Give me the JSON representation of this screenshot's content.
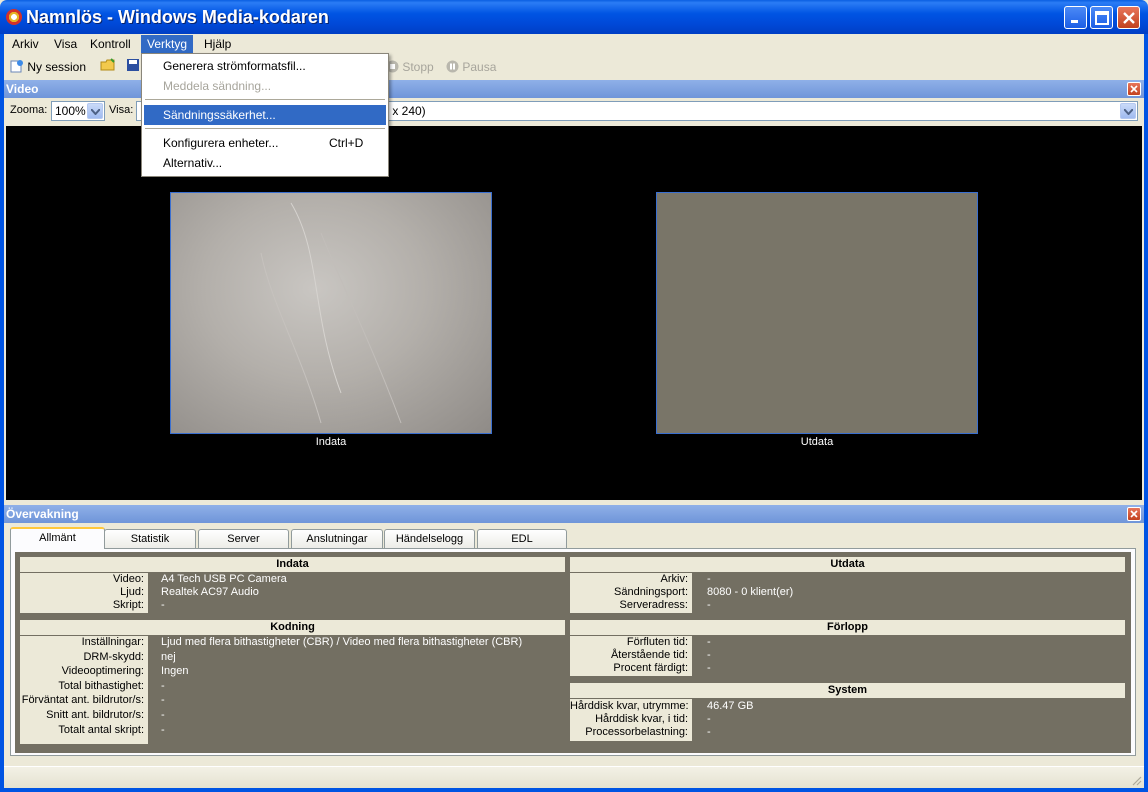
{
  "window": {
    "title": "Namnlös - Windows Media-kodaren"
  },
  "menubar": {
    "items": [
      "Arkiv",
      "Visa",
      "Kontroll",
      "Verktyg",
      "Hjälp"
    ],
    "active": "Verktyg"
  },
  "toolbar": {
    "new_session": "Ny session",
    "stop": "Stopp",
    "pause": "Pausa"
  },
  "dropdown": {
    "items": [
      {
        "label": "Generera strömformatsfil...",
        "state": "enabled"
      },
      {
        "label": "Meddela sändning...",
        "state": "disabled"
      },
      {
        "label": "Sändningssäkerhet...",
        "state": "highlighted"
      },
      {
        "label": "Konfigurera enheter...",
        "shortcut": "Ctrl+D",
        "state": "enabled"
      },
      {
        "label": "Alternativ...",
        "state": "enabled"
      }
    ]
  },
  "video_panel": {
    "title": "Video",
    "zoom_label": "Zooma:",
    "zoom_value": "100%",
    "view_label": "Visa:",
    "view_value_visible": ") x 240)",
    "input_label": "Indata",
    "output_label": "Utdata"
  },
  "monitor_panel": {
    "title": "Övervakning",
    "tabs": [
      "Allmänt",
      "Statistik",
      "Server",
      "Anslutningar",
      "Händelselogg",
      "EDL"
    ],
    "active_tab": "Allmänt",
    "input": {
      "title": "Indata",
      "rows": [
        {
          "label": "Video:",
          "value": "A4 Tech USB PC Camera"
        },
        {
          "label": "Ljud:",
          "value": "Realtek AC97 Audio"
        },
        {
          "label": "Skript:",
          "value": "-"
        }
      ]
    },
    "encoding": {
      "title": "Kodning",
      "rows": [
        {
          "label": "Inställningar:",
          "value": "Ljud med flera bithastigheter (CBR) / Video med flera bithastigheter (CBR)"
        },
        {
          "label": "DRM-skydd:",
          "value": "nej"
        },
        {
          "label": "Videooptimering:",
          "value": "Ingen"
        },
        {
          "label": "Total bithastighet:",
          "value": "-"
        },
        {
          "label": "Förväntat ant. bildrutor/s:",
          "value": "-"
        },
        {
          "label": "Snitt ant. bildrutor/s:",
          "value": "-"
        },
        {
          "label": "Totalt antal skript:",
          "value": "-"
        }
      ]
    },
    "output": {
      "title": "Utdata",
      "rows": [
        {
          "label": "Arkiv:",
          "value": "-"
        },
        {
          "label": "Sändningsport:",
          "value": "8080 - 0 klient(er)"
        },
        {
          "label": "Serveradress:",
          "value": "-"
        }
      ]
    },
    "progress": {
      "title": "Förlopp",
      "rows": [
        {
          "label": "Förfluten tid:",
          "value": "-"
        },
        {
          "label": "Återstående tid:",
          "value": "-"
        },
        {
          "label": "Procent färdigt:",
          "value": "-"
        }
      ]
    },
    "system": {
      "title": "System",
      "rows": [
        {
          "label": "Hårddisk kvar, utrymme:",
          "value": "46.47 GB"
        },
        {
          "label": "Hårddisk kvar, i tid:",
          "value": "-"
        },
        {
          "label": "Processorbelastning:",
          "value": "-"
        }
      ]
    }
  },
  "colors": {
    "titlebar": "#0054e3",
    "highlight": "#316ac5",
    "monitor_bg": "#736f62",
    "output_preview": "#797568"
  }
}
